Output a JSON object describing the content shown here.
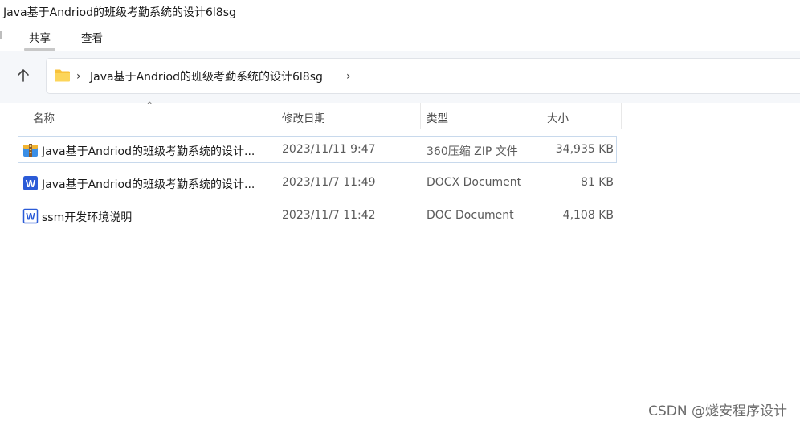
{
  "window": {
    "title": "Java基于Andriod的班级考勤系统的设计6l8sg"
  },
  "ribbon": {
    "tabs": [
      {
        "label": "共享",
        "active": true
      },
      {
        "label": "查看",
        "active": false
      }
    ]
  },
  "address_bar": {
    "up_icon": "arrow-up-icon",
    "folder_icon": "folder-icon",
    "path": "Java基于Andriod的班级考勤系统的设计6l8sg",
    "chevron": "›"
  },
  "columns": {
    "name": "名称",
    "modified": "修改日期",
    "type": "类型",
    "size": "大小",
    "sort_indicator": "^"
  },
  "files": [
    {
      "name": "Java基于Andriod的班级考勤系统的设计...",
      "modified": "2023/11/11 9:47",
      "type": "360压缩 ZIP 文件",
      "size": "34,935 KB",
      "icon": "zip-archive-icon",
      "selected": true
    },
    {
      "name": "Java基于Andriod的班级考勤系统的设计...",
      "modified": "2023/11/7 11:49",
      "type": "DOCX Document",
      "size": "81 KB",
      "icon": "word-document-icon",
      "selected": false
    },
    {
      "name": "ssm开发环境说明",
      "modified": "2023/11/7 11:42",
      "type": "DOC Document",
      "size": "4,108 KB",
      "icon": "word-doc-icon",
      "selected": false
    }
  ],
  "watermark": "CSDN @燧安程序设计",
  "colors": {
    "address_zone_bg": "#f5f7fa",
    "selection_border": "#c8d9ec",
    "word_blue": "#2b5bd7",
    "folder_yellow": "#f8c23b"
  }
}
